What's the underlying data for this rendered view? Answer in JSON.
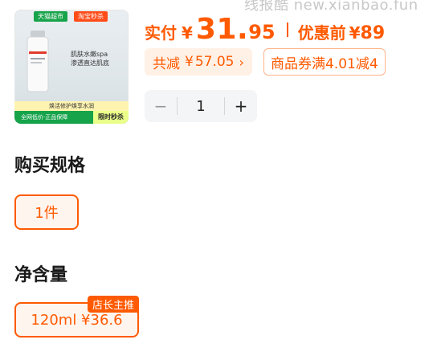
{
  "watermark": {
    "text": "线报酷 new.xianbao.fun"
  },
  "product_image": {
    "tag_left": "天猫超市",
    "tag_right": "淘宝秒杀",
    "line1": "肌肤水嫩spa",
    "line2": "渗透直达肌底",
    "stripe": "焕活修护焕享水润",
    "bar_left": "全网低价·正品保障",
    "bar_right": "限时秒杀",
    "bottle_label": "120ml"
  },
  "price": {
    "label": "实付",
    "currency": "¥",
    "integer": "31.",
    "decimal": "95",
    "before_label": "优惠前",
    "before_currency": "¥",
    "before_value": "89"
  },
  "discount": {
    "label": "共减",
    "currency": "¥",
    "value": "57.05",
    "chevron": "›"
  },
  "coupon": {
    "text": "商品券满4.01减4"
  },
  "quantity": {
    "minus": "−",
    "value": "1",
    "plus": "+"
  },
  "spec": {
    "title": "购买规格",
    "options": [
      {
        "label": "1件",
        "selected": true
      }
    ]
  },
  "volume": {
    "title": "净含量",
    "options": [
      {
        "label": "120ml  ¥36.6",
        "badge": "店长主推",
        "selected": true
      }
    ]
  },
  "colors": {
    "accent": "#ff5a00",
    "accent_bg": "#fff1e6",
    "green": "#16a34a"
  }
}
